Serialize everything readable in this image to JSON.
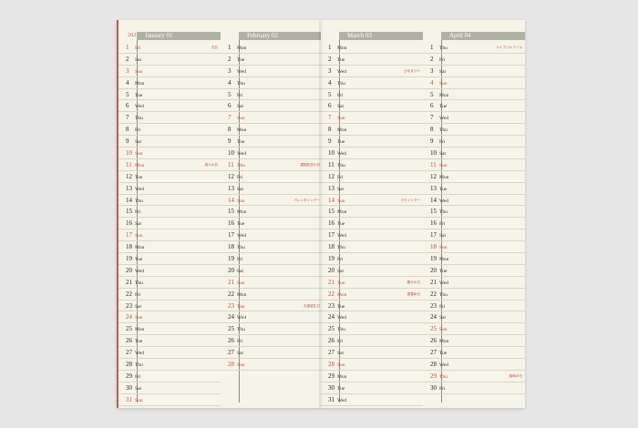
{
  "year": "2027",
  "months": [
    {
      "name": "January 01",
      "days": [
        {
          "d": "1",
          "w": "Fri",
          "h": true,
          "note": "元日"
        },
        {
          "d": "2",
          "w": "Sat"
        },
        {
          "d": "3",
          "w": "Sun",
          "h": true
        },
        {
          "d": "4",
          "w": "Mon"
        },
        {
          "d": "5",
          "w": "Tue"
        },
        {
          "d": "6",
          "w": "Wed"
        },
        {
          "d": "7",
          "w": "Thu"
        },
        {
          "d": "8",
          "w": "Fri"
        },
        {
          "d": "9",
          "w": "Sat"
        },
        {
          "d": "10",
          "w": "Sun",
          "h": true
        },
        {
          "d": "11",
          "w": "Mon",
          "h": true,
          "note": "成人の日"
        },
        {
          "d": "12",
          "w": "Tue"
        },
        {
          "d": "13",
          "w": "Wed"
        },
        {
          "d": "14",
          "w": "Thu"
        },
        {
          "d": "15",
          "w": "Fri"
        },
        {
          "d": "16",
          "w": "Sat"
        },
        {
          "d": "17",
          "w": "Sun",
          "h": true
        },
        {
          "d": "18",
          "w": "Mon"
        },
        {
          "d": "19",
          "w": "Tue"
        },
        {
          "d": "20",
          "w": "Wed"
        },
        {
          "d": "21",
          "w": "Thu"
        },
        {
          "d": "22",
          "w": "Fri"
        },
        {
          "d": "23",
          "w": "Sat"
        },
        {
          "d": "24",
          "w": "Sun",
          "h": true
        },
        {
          "d": "25",
          "w": "Mon"
        },
        {
          "d": "26",
          "w": "Tue"
        },
        {
          "d": "27",
          "w": "Wed"
        },
        {
          "d": "28",
          "w": "Thu"
        },
        {
          "d": "29",
          "w": "Fri"
        },
        {
          "d": "30",
          "w": "Sat"
        },
        {
          "d": "31",
          "w": "Sun",
          "h": true
        }
      ]
    },
    {
      "name": "February 02",
      "days": [
        {
          "d": "1",
          "w": "Mon"
        },
        {
          "d": "2",
          "w": "Tue"
        },
        {
          "d": "3",
          "w": "Wed"
        },
        {
          "d": "4",
          "w": "Thu"
        },
        {
          "d": "5",
          "w": "Fri"
        },
        {
          "d": "6",
          "w": "Sat"
        },
        {
          "d": "7",
          "w": "Sun",
          "h": true
        },
        {
          "d": "8",
          "w": "Mon"
        },
        {
          "d": "9",
          "w": "Tue"
        },
        {
          "d": "10",
          "w": "Wed"
        },
        {
          "d": "11",
          "w": "Thu",
          "h": true,
          "note": "建国記念の日"
        },
        {
          "d": "12",
          "w": "Fri"
        },
        {
          "d": "13",
          "w": "Sat"
        },
        {
          "d": "14",
          "w": "Sun",
          "h": true,
          "note": "バレンタインデー"
        },
        {
          "d": "15",
          "w": "Mon"
        },
        {
          "d": "16",
          "w": "Tue"
        },
        {
          "d": "17",
          "w": "Wed"
        },
        {
          "d": "18",
          "w": "Thu"
        },
        {
          "d": "19",
          "w": "Fri"
        },
        {
          "d": "20",
          "w": "Sat"
        },
        {
          "d": "21",
          "w": "Sun",
          "h": true
        },
        {
          "d": "22",
          "w": "Mon"
        },
        {
          "d": "23",
          "w": "Tue",
          "h": true,
          "note": "天皇誕生日"
        },
        {
          "d": "24",
          "w": "Wed"
        },
        {
          "d": "25",
          "w": "Thu"
        },
        {
          "d": "26",
          "w": "Fri"
        },
        {
          "d": "27",
          "w": "Sat"
        },
        {
          "d": "28",
          "w": "Sun",
          "h": true
        }
      ]
    },
    {
      "name": "March 03",
      "days": [
        {
          "d": "1",
          "w": "Mon"
        },
        {
          "d": "2",
          "w": "Tue"
        },
        {
          "d": "3",
          "w": "Wed",
          "note": "ひなまつり"
        },
        {
          "d": "4",
          "w": "Thu"
        },
        {
          "d": "5",
          "w": "Fri"
        },
        {
          "d": "6",
          "w": "Sat"
        },
        {
          "d": "7",
          "w": "Sun",
          "h": true
        },
        {
          "d": "8",
          "w": "Mon"
        },
        {
          "d": "9",
          "w": "Tue"
        },
        {
          "d": "10",
          "w": "Wed"
        },
        {
          "d": "11",
          "w": "Thu"
        },
        {
          "d": "12",
          "w": "Fri"
        },
        {
          "d": "13",
          "w": "Sat"
        },
        {
          "d": "14",
          "w": "Sun",
          "h": true,
          "note": "ホワイトデー"
        },
        {
          "d": "15",
          "w": "Mon"
        },
        {
          "d": "16",
          "w": "Tue"
        },
        {
          "d": "17",
          "w": "Wed"
        },
        {
          "d": "18",
          "w": "Thu"
        },
        {
          "d": "19",
          "w": "Fri"
        },
        {
          "d": "20",
          "w": "Sat"
        },
        {
          "d": "21",
          "w": "Sun",
          "h": true,
          "note": "春分の日"
        },
        {
          "d": "22",
          "w": "Mon",
          "h": true,
          "note": "振替休日"
        },
        {
          "d": "23",
          "w": "Tue"
        },
        {
          "d": "24",
          "w": "Wed"
        },
        {
          "d": "25",
          "w": "Thu"
        },
        {
          "d": "26",
          "w": "Fri"
        },
        {
          "d": "27",
          "w": "Sat"
        },
        {
          "d": "28",
          "w": "Sun",
          "h": true
        },
        {
          "d": "29",
          "w": "Mon"
        },
        {
          "d": "30",
          "w": "Tue"
        },
        {
          "d": "31",
          "w": "Wed"
        }
      ]
    },
    {
      "name": "April 04",
      "days": [
        {
          "d": "1",
          "w": "Thu",
          "note": "エイプリルフール"
        },
        {
          "d": "2",
          "w": "Fri"
        },
        {
          "d": "3",
          "w": "Sat"
        },
        {
          "d": "4",
          "w": "Sun",
          "h": true
        },
        {
          "d": "5",
          "w": "Mon"
        },
        {
          "d": "6",
          "w": "Tue"
        },
        {
          "d": "7",
          "w": "Wed"
        },
        {
          "d": "8",
          "w": "Thu"
        },
        {
          "d": "9",
          "w": "Fri"
        },
        {
          "d": "10",
          "w": "Sat"
        },
        {
          "d": "11",
          "w": "Sun",
          "h": true
        },
        {
          "d": "12",
          "w": "Mon"
        },
        {
          "d": "13",
          "w": "Tue"
        },
        {
          "d": "14",
          "w": "Wed"
        },
        {
          "d": "15",
          "w": "Thu"
        },
        {
          "d": "16",
          "w": "Fri"
        },
        {
          "d": "17",
          "w": "Sat"
        },
        {
          "d": "18",
          "w": "Sun",
          "h": true
        },
        {
          "d": "19",
          "w": "Mon"
        },
        {
          "d": "20",
          "w": "Tue"
        },
        {
          "d": "21",
          "w": "Wed"
        },
        {
          "d": "22",
          "w": "Thu"
        },
        {
          "d": "23",
          "w": "Fri"
        },
        {
          "d": "24",
          "w": "Sat"
        },
        {
          "d": "25",
          "w": "Sun",
          "h": true
        },
        {
          "d": "26",
          "w": "Mon"
        },
        {
          "d": "27",
          "w": "Tue"
        },
        {
          "d": "28",
          "w": "Wed"
        },
        {
          "d": "29",
          "w": "Thu",
          "h": true,
          "note": "昭和の日"
        },
        {
          "d": "30",
          "w": "Fri"
        }
      ]
    }
  ],
  "colors": {
    "background": "#e6e6e6",
    "paper": "#f6f4e9",
    "header": "#b0b1a5",
    "holiday": "#c54a42",
    "edge": "#b5605a"
  }
}
